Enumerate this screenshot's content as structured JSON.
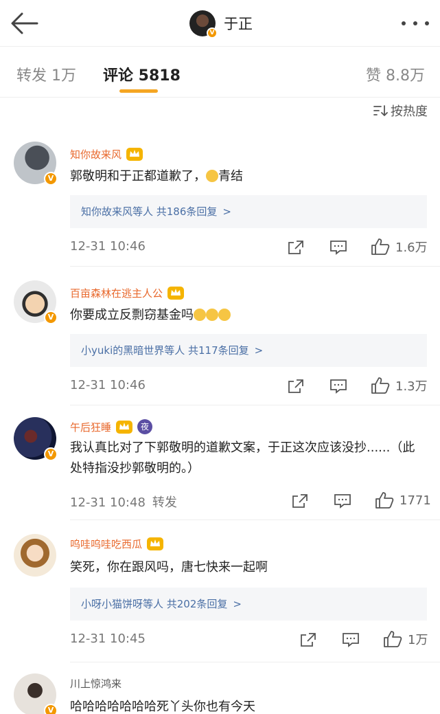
{
  "header": {
    "title": "于正",
    "back_icon": "back-arrow-icon",
    "more_icon": "more-dots-icon",
    "verified_badge": "V"
  },
  "tabs": {
    "repost": "转发 1万",
    "comments": "评论 5818",
    "likes": "赞 8.8万",
    "active_color": "#f5a623"
  },
  "sort": {
    "label": "按热度",
    "icon": "sort-icon"
  },
  "comments": [
    {
      "user": "知你故来风",
      "text_before": "郭敬明和于正都道歉了，",
      "text_after": "青结",
      "reply": "知你故来风等人  共186条回复",
      "reply_arrow": ">",
      "time": "12-31 10:46",
      "likes": "1.6万"
    },
    {
      "user": "百亩森林在逃主人公",
      "text": "你要成立反剽窃基金吗",
      "reply": "小yuki的黑暗世界等人  共117条回复",
      "reply_arrow": ">",
      "time": "12-31 10:46",
      "likes": "1.3万"
    },
    {
      "user": "午后狂睡",
      "night_badge": "夜",
      "text": "我认真比对了下郭敬明的道歉文案，于正这次应该没抄......（此处特指没抄郭敬明的。）",
      "time": "12-31 10:48",
      "repost_tag": "转发",
      "likes": "1771"
    },
    {
      "user": "呜哇呜哇吃西瓜",
      "text": "笑死，你在跟风吗，唐七快来一起啊",
      "reply": "小呀小猫饼呀等人  共202条回复",
      "reply_arrow": ">",
      "time": "12-31 10:45",
      "likes": "1万"
    },
    {
      "user": "川上惊鸿来",
      "text": "哈哈哈哈哈哈哈死丫头你也有今天"
    }
  ],
  "colors": {
    "nickname": "#e8682c",
    "reply_link": "#4a6fa5",
    "badge": "#f39800"
  }
}
